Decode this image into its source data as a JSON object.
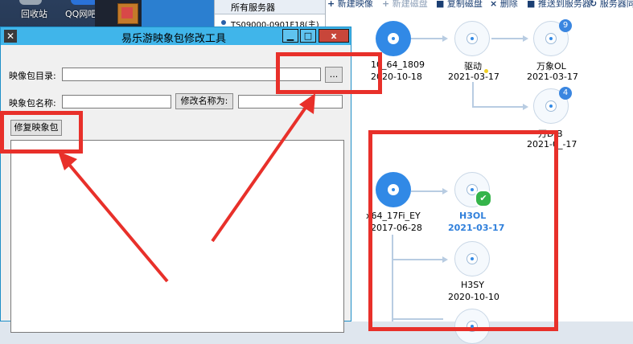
{
  "desktop": {
    "icons": [
      {
        "label": "回收站",
        "icon": "recycle-bin-icon"
      },
      {
        "label": "QQ网吧网关",
        "icon": "qq-gateway-icon"
      }
    ]
  },
  "server_list": {
    "header": "所有服务器",
    "item": "TS09000-0901F18(主)"
  },
  "toolbar": {
    "items": [
      {
        "label": "新建映像",
        "enabled": true
      },
      {
        "label": "新建磁盘",
        "enabled": false
      },
      {
        "label": "复制磁盘",
        "enabled": true
      },
      {
        "label": "删除",
        "enabled": true
      },
      {
        "label": "推送到服务器",
        "enabled": true
      },
      {
        "label": "服务器同",
        "enabled": true
      }
    ]
  },
  "tree": {
    "group1": {
      "root": {
        "name": "10_64_1809",
        "date": "2020-10-18"
      },
      "driver": {
        "name": "驱动",
        "date": "2021-03-17"
      },
      "wanxiang": {
        "name": "万象OL",
        "date": "2021-03-17",
        "badge": "9"
      },
      "fourth": {
        "name": "万D B",
        "date": "2021-0_-17",
        "badge": "4"
      }
    },
    "group2": {
      "root": {
        "name": "x64_17Fi_EY",
        "date": "2017-06-28"
      },
      "h3ol": {
        "name": "H3OL",
        "date": "2021-03-17",
        "status": "selected"
      },
      "h3sy": {
        "name": "H3SY",
        "date": "2020-10-10"
      }
    }
  },
  "dialog": {
    "title": "易乐游映象包修改工具",
    "dir_label": "映像包目录:",
    "dir_value": "",
    "browse_label": "...",
    "name_label": "映象包名称:",
    "name_value": "",
    "rename_button": "修改名称为:",
    "rename_value": "",
    "repair_button": "修复映象包",
    "log_text": "",
    "min_label": "▁",
    "max_label": "□",
    "close_label": "x"
  },
  "colors": {
    "accent": "#40b5ea",
    "annotation_red": "#e8302a",
    "node_blue": "#3189e6",
    "check_green": "#35b44a"
  }
}
